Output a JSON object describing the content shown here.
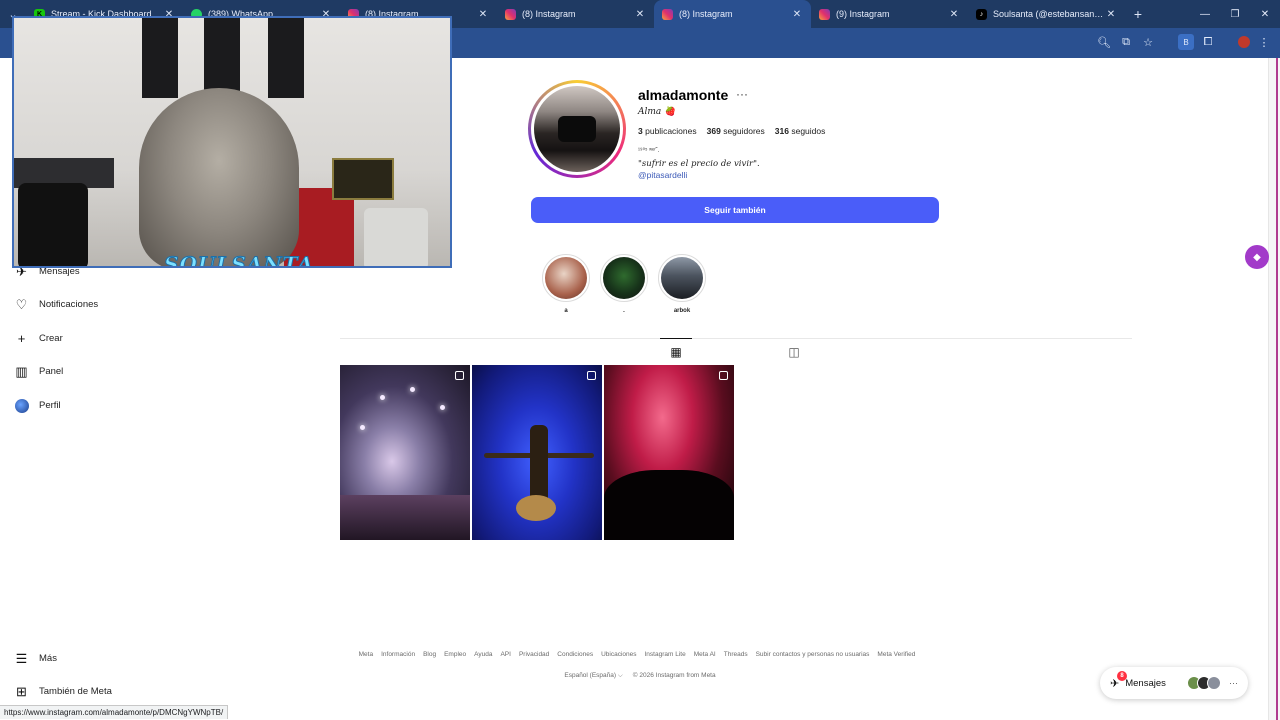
{
  "browser": {
    "tabs": [
      {
        "label": "Stream - Kick Dashboard",
        "icon": "kick",
        "active": false
      },
      {
        "label": "(389) WhatsApp",
        "icon": "whatsapp",
        "active": false
      },
      {
        "label": "(8) Instagram",
        "icon": "instagram",
        "active": false
      },
      {
        "label": "(8) Instagram",
        "icon": "instagram",
        "active": false
      },
      {
        "label": "(8) Instagram",
        "icon": "instagram",
        "active": true
      },
      {
        "label": "(9) Instagram",
        "icon": "instagram",
        "active": false
      },
      {
        "label": "Soulsanta (@estebansantacruz",
        "icon": "tiktok",
        "active": false
      }
    ],
    "new_tab": "+",
    "close_glyph": "✕"
  },
  "sidebar": {
    "items": [
      {
        "label": "Mensajes",
        "icon": "messenger-icon"
      },
      {
        "label": "Notificaciones",
        "icon": "heart-icon"
      },
      {
        "label": "Crear",
        "icon": "plus-icon"
      },
      {
        "label": "Panel",
        "icon": "chart-icon"
      },
      {
        "label": "Perfil",
        "icon": "avatar"
      }
    ],
    "bottom": [
      {
        "label": "Más",
        "icon": "menu-icon"
      },
      {
        "label": "También de Meta",
        "icon": "meta-icon"
      }
    ]
  },
  "profile": {
    "username": "almadamonte",
    "more": "···",
    "full_name": "Alma 🍓",
    "posts_count": "3",
    "posts_label": "publicaciones",
    "followers_count": "369",
    "followers_label": "seguidores",
    "following_count": "316",
    "following_label": "seguidos",
    "bio_line1": "¹⁹⁰⁵ ʷᵉʳ˘.",
    "bio_line2": "\"sufrir es el precio de vivir\".",
    "bio_link": "@pitasardelli",
    "follow_button": "Seguir también"
  },
  "highlights": [
    {
      "label": "a"
    },
    {
      "label": "."
    },
    {
      "label": "arbok"
    }
  ],
  "footer": {
    "links": [
      "Meta",
      "Información",
      "Blog",
      "Empleo",
      "Ayuda",
      "API",
      "Privacidad",
      "Condiciones",
      "Ubicaciones",
      "Instagram Lite",
      "Meta AI",
      "Threads",
      "Subir contactos y personas no usuarias",
      "Meta Verified"
    ],
    "language": "Español (España) ⌵",
    "copyright": "© 2026 Instagram from Meta"
  },
  "messages_pill": {
    "label": "Mensajes",
    "badge": "8"
  },
  "status_url": "https://www.instagram.com/almadamonte/p/DMCNgYWNpTB/",
  "webcam": {
    "logo_text": "SOULSANTA"
  },
  "colors": {
    "follow_button": "#4a5df9",
    "tabbar": "#1f3a63",
    "link": "#3d5bb8"
  }
}
